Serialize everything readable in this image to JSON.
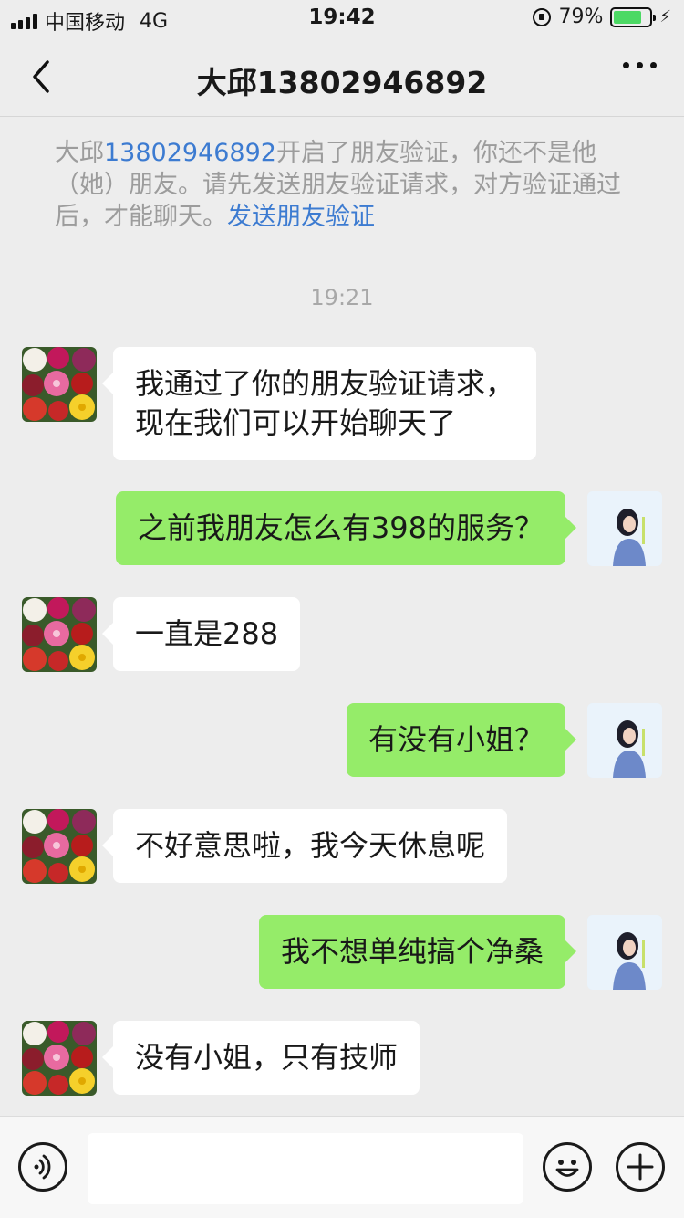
{
  "status_bar": {
    "carrier": "中国移动",
    "network": "4G",
    "time": "19:42",
    "battery": "79%",
    "battery_level": 0.79
  },
  "nav": {
    "title": "大邱13802946892"
  },
  "notice": {
    "name": "大邱",
    "phone": "13802946892",
    "text": "开启了朋友验证，你还不是他（她）朋友。请先发送朋友验证请求，对方验证通过后，才能聊天。",
    "link": "发送朋友验证"
  },
  "timestamp": "19:21",
  "messages": [
    {
      "from": "other",
      "lines": [
        "我通过了你的朋友验证请求，",
        "现在我们可以开始聊天了"
      ]
    },
    {
      "from": "me",
      "lines": [
        "之前我朋友怎么有398的服务？"
      ]
    },
    {
      "from": "other",
      "lines": [
        "一直是288"
      ]
    },
    {
      "from": "me",
      "lines": [
        "有没有小姐？"
      ]
    },
    {
      "from": "other",
      "lines": [
        "不好意思啦，我今天休息呢"
      ]
    },
    {
      "from": "me",
      "lines": [
        "我不想单纯搞个净桑"
      ]
    },
    {
      "from": "other",
      "lines": [
        "没有小姐，只有技师"
      ]
    }
  ],
  "colors": {
    "background": "#ededed",
    "outgoing_bubble": "#95ec69",
    "incoming_bubble": "#ffffff",
    "link": "#3c7bd1"
  }
}
